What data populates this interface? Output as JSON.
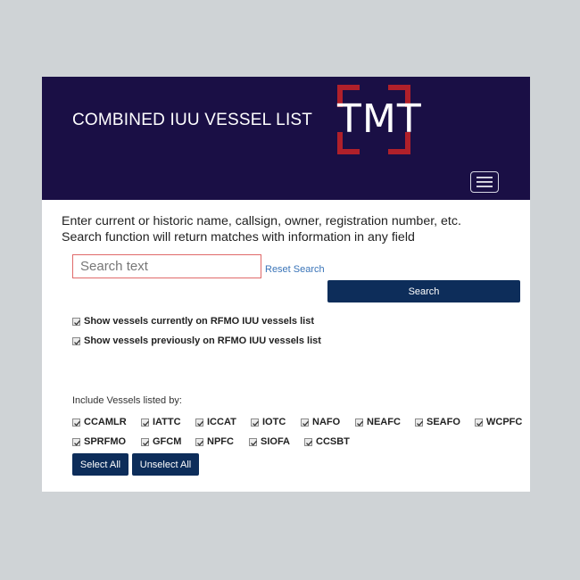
{
  "header": {
    "title": "COMBINED IUU VESSEL LIST",
    "logo_text": "TMT",
    "logo_color": "#b0202a",
    "background_color": "#1a0f45",
    "menu_icon": "hamburger-menu-icon"
  },
  "intro": {
    "line1": "Enter current or historic name, callsign, owner, registration number, etc.",
    "line2": "Search function will return matches with information in any field"
  },
  "search": {
    "placeholder": "Search text",
    "value": "",
    "reset_label": "Reset Search",
    "button_label": "Search",
    "button_color": "#0d2d5a"
  },
  "filters": {
    "current": {
      "label": "Show vessels currently on RFMO IUU vessels list",
      "checked": true
    },
    "previous": {
      "label": "Show vessels previously on RFMO IUU vessels list",
      "checked": true
    }
  },
  "rfmo": {
    "label": "Include Vessels listed by:",
    "items": [
      {
        "label": "CCAMLR",
        "checked": true
      },
      {
        "label": "IATTC",
        "checked": true
      },
      {
        "label": "ICCAT",
        "checked": true
      },
      {
        "label": "IOTC",
        "checked": true
      },
      {
        "label": "NAFO",
        "checked": true
      },
      {
        "label": "NEAFC",
        "checked": true
      },
      {
        "label": "SEAFO",
        "checked": true
      },
      {
        "label": "WCPFC",
        "checked": true
      },
      {
        "label": "SPRFMO",
        "checked": true
      },
      {
        "label": "GFCM",
        "checked": true
      },
      {
        "label": "NPFC",
        "checked": true
      },
      {
        "label": "SIOFA",
        "checked": true
      },
      {
        "label": "CCSBT",
        "checked": true
      }
    ],
    "select_all_label": "Select All",
    "unselect_all_label": "Unselect All"
  }
}
